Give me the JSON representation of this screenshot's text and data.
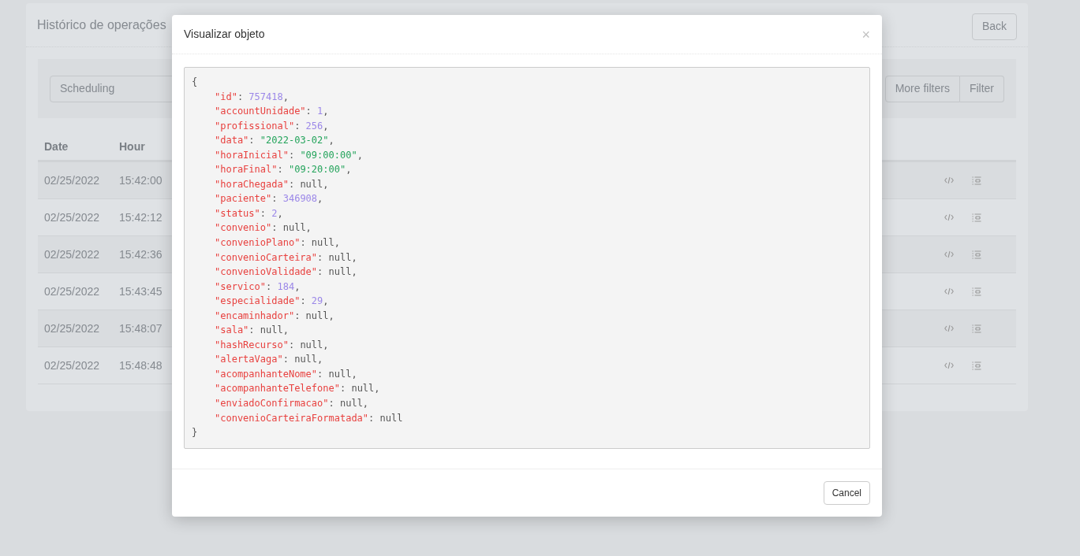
{
  "page": {
    "title": "Histórico de operações",
    "back_button": "Back",
    "filter_input": {
      "value": "Scheduling"
    },
    "filter_buttons": [
      "More filters",
      "Filter"
    ],
    "table": {
      "columns": [
        "Date",
        "Hour"
      ],
      "rows": [
        {
          "date": "02/25/2022",
          "hour": "15:42:00"
        },
        {
          "date": "02/25/2022",
          "hour": "15:42:12"
        },
        {
          "date": "02/25/2022",
          "hour": "15:42:36"
        },
        {
          "date": "02/25/2022",
          "hour": "15:43:45"
        },
        {
          "date": "02/25/2022",
          "hour": "15:48:07"
        },
        {
          "date": "02/25/2022",
          "hour": "15:48:48"
        }
      ]
    }
  },
  "modal": {
    "title": "Visualizar objeto",
    "close": "×",
    "open_brace": "{",
    "close_brace": "}",
    "cancel_button": "Cancel",
    "lines": [
      {
        "key": "\"id\"",
        "sep": ": ",
        "value": "757418",
        "kind": "number",
        "end": ","
      },
      {
        "key": "\"accountUnidade\"",
        "sep": ": ",
        "value": "1",
        "kind": "number",
        "end": ","
      },
      {
        "key": "\"profissional\"",
        "sep": ": ",
        "value": "256",
        "kind": "number",
        "end": ","
      },
      {
        "key": "\"data\"",
        "sep": ": ",
        "value": "\"2022-03-02\"",
        "kind": "string",
        "end": ","
      },
      {
        "key": "\"horaInicial\"",
        "sep": ": ",
        "value": "\"09:00:00\"",
        "kind": "string",
        "end": ","
      },
      {
        "key": "\"horaFinal\"",
        "sep": ": ",
        "value": "\"09:20:00\"",
        "kind": "string",
        "end": ","
      },
      {
        "key": "\"horaChegada\"",
        "sep": ": ",
        "value": "null",
        "kind": "null",
        "end": ","
      },
      {
        "key": "\"paciente\"",
        "sep": ": ",
        "value": "346908",
        "kind": "number",
        "end": ","
      },
      {
        "key": "\"status\"",
        "sep": ": ",
        "value": "2",
        "kind": "number",
        "end": ","
      },
      {
        "key": "\"convenio\"",
        "sep": ": ",
        "value": "null",
        "kind": "null",
        "end": ","
      },
      {
        "key": "\"convenioPlano\"",
        "sep": ": ",
        "value": "null",
        "kind": "null",
        "end": ","
      },
      {
        "key": "\"convenioCarteira\"",
        "sep": ": ",
        "value": "null",
        "kind": "null",
        "end": ","
      },
      {
        "key": "\"convenioValidade\"",
        "sep": ": ",
        "value": "null",
        "kind": "null",
        "end": ","
      },
      {
        "key": "\"servico\"",
        "sep": ": ",
        "value": "184",
        "kind": "number",
        "end": ","
      },
      {
        "key": "\"especialidade\"",
        "sep": ": ",
        "value": "29",
        "kind": "number",
        "end": ","
      },
      {
        "key": "\"encaminhador\"",
        "sep": ": ",
        "value": "null",
        "kind": "null",
        "end": ","
      },
      {
        "key": "\"sala\"",
        "sep": ": ",
        "value": "null",
        "kind": "null",
        "end": ","
      },
      {
        "key": "\"hashRecurso\"",
        "sep": ": ",
        "value": "null",
        "kind": "null",
        "end": ","
      },
      {
        "key": "\"alertaVaga\"",
        "sep": ": ",
        "value": "null",
        "kind": "null",
        "end": ","
      },
      {
        "key": "\"acompanhanteNome\"",
        "sep": ": ",
        "value": "null",
        "kind": "null",
        "end": ","
      },
      {
        "key": "\"acompanhanteTelefone\"",
        "sep": ": ",
        "value": "null",
        "kind": "null",
        "end": ","
      },
      {
        "key": "\"enviadoConfirmacao\"",
        "sep": ": ",
        "value": "null",
        "kind": "null",
        "end": ","
      },
      {
        "key": "\"convenioCarteiraFormatada\"",
        "sep": ": ",
        "value": "null",
        "kind": "null"
      }
    ]
  }
}
